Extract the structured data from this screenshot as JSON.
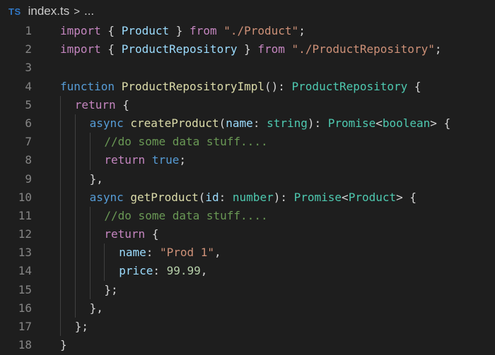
{
  "breadcrumb": {
    "language_badge": "TS",
    "file_name": "index.ts",
    "separator": ">",
    "more": "..."
  },
  "colors": {
    "background": "#1e1e1e",
    "line_number": "#858585",
    "keyword_control": "#c586c0",
    "keyword_storage": "#569cd6",
    "function": "#dcdcaa",
    "type": "#4ec9b0",
    "string": "#ce9178",
    "variable": "#9cdcfe",
    "number": "#b5cea8",
    "comment": "#6a9955",
    "ts_badge": "#3178c6"
  },
  "lines": [
    {
      "number": "1",
      "indent": 0,
      "tokens": [
        {
          "t": "import",
          "c": "kw"
        },
        {
          "t": " { ",
          "c": "pn"
        },
        {
          "t": "Product",
          "c": "var"
        },
        {
          "t": " } ",
          "c": "pn"
        },
        {
          "t": "from",
          "c": "kw"
        },
        {
          "t": " ",
          "c": "pn"
        },
        {
          "t": "\"./Product\"",
          "c": "str"
        },
        {
          "t": ";",
          "c": "pn"
        }
      ]
    },
    {
      "number": "2",
      "indent": 0,
      "tokens": [
        {
          "t": "import",
          "c": "kw"
        },
        {
          "t": " { ",
          "c": "pn"
        },
        {
          "t": "ProductRepository",
          "c": "var"
        },
        {
          "t": " } ",
          "c": "pn"
        },
        {
          "t": "from",
          "c": "kw"
        },
        {
          "t": " ",
          "c": "pn"
        },
        {
          "t": "\"./ProductRepository\"",
          "c": "str"
        },
        {
          "t": ";",
          "c": "pn"
        }
      ]
    },
    {
      "number": "3",
      "indent": 0,
      "tokens": []
    },
    {
      "number": "4",
      "indent": 0,
      "tokens": [
        {
          "t": "function",
          "c": "kwb"
        },
        {
          "t": " ",
          "c": "pn"
        },
        {
          "t": "ProductRepositoryImpl",
          "c": "fn"
        },
        {
          "t": "(): ",
          "c": "pn"
        },
        {
          "t": "ProductRepository",
          "c": "ty"
        },
        {
          "t": " {",
          "c": "pn"
        }
      ]
    },
    {
      "number": "5",
      "indent": 1,
      "tokens": [
        {
          "t": "return",
          "c": "kw"
        },
        {
          "t": " {",
          "c": "pn"
        }
      ]
    },
    {
      "number": "6",
      "indent": 2,
      "tokens": [
        {
          "t": "async",
          "c": "kwb"
        },
        {
          "t": " ",
          "c": "pn"
        },
        {
          "t": "createProduct",
          "c": "fn"
        },
        {
          "t": "(",
          "c": "pn"
        },
        {
          "t": "name",
          "c": "var"
        },
        {
          "t": ": ",
          "c": "pn"
        },
        {
          "t": "string",
          "c": "ty"
        },
        {
          "t": "): ",
          "c": "pn"
        },
        {
          "t": "Promise",
          "c": "ty"
        },
        {
          "t": "<",
          "c": "pn"
        },
        {
          "t": "boolean",
          "c": "ty"
        },
        {
          "t": "> {",
          "c": "pn"
        }
      ]
    },
    {
      "number": "7",
      "indent": 3,
      "tokens": [
        {
          "t": "//do some data stuff....",
          "c": "cm"
        }
      ]
    },
    {
      "number": "8",
      "indent": 3,
      "tokens": [
        {
          "t": "return",
          "c": "kw"
        },
        {
          "t": " ",
          "c": "pn"
        },
        {
          "t": "true",
          "c": "kwb"
        },
        {
          "t": ";",
          "c": "pn"
        }
      ]
    },
    {
      "number": "9",
      "indent": 2,
      "tokens": [
        {
          "t": "},",
          "c": "pn"
        }
      ]
    },
    {
      "number": "10",
      "indent": 2,
      "tokens": [
        {
          "t": "async",
          "c": "kwb"
        },
        {
          "t": " ",
          "c": "pn"
        },
        {
          "t": "getProduct",
          "c": "fn"
        },
        {
          "t": "(",
          "c": "pn"
        },
        {
          "t": "id",
          "c": "var"
        },
        {
          "t": ": ",
          "c": "pn"
        },
        {
          "t": "number",
          "c": "ty"
        },
        {
          "t": "): ",
          "c": "pn"
        },
        {
          "t": "Promise",
          "c": "ty"
        },
        {
          "t": "<",
          "c": "pn"
        },
        {
          "t": "Product",
          "c": "ty"
        },
        {
          "t": "> {",
          "c": "pn"
        }
      ]
    },
    {
      "number": "11",
      "indent": 3,
      "tokens": [
        {
          "t": "//do some data stuff....",
          "c": "cm"
        }
      ]
    },
    {
      "number": "12",
      "indent": 3,
      "tokens": [
        {
          "t": "return",
          "c": "kw"
        },
        {
          "t": " {",
          "c": "pn"
        }
      ]
    },
    {
      "number": "13",
      "indent": 4,
      "tokens": [
        {
          "t": "name",
          "c": "var"
        },
        {
          "t": ": ",
          "c": "pn"
        },
        {
          "t": "\"Prod 1\"",
          "c": "str"
        },
        {
          "t": ",",
          "c": "pn"
        }
      ]
    },
    {
      "number": "14",
      "indent": 4,
      "tokens": [
        {
          "t": "price",
          "c": "var"
        },
        {
          "t": ": ",
          "c": "pn"
        },
        {
          "t": "99.99",
          "c": "num"
        },
        {
          "t": ",",
          "c": "pn"
        }
      ]
    },
    {
      "number": "15",
      "indent": 3,
      "tokens": [
        {
          "t": "};",
          "c": "pn"
        }
      ]
    },
    {
      "number": "16",
      "indent": 2,
      "tokens": [
        {
          "t": "},",
          "c": "pn"
        }
      ]
    },
    {
      "number": "17",
      "indent": 1,
      "tokens": [
        {
          "t": "};",
          "c": "pn"
        }
      ]
    },
    {
      "number": "18",
      "indent": 0,
      "tokens": [
        {
          "t": "}",
          "c": "pn"
        }
      ]
    }
  ]
}
